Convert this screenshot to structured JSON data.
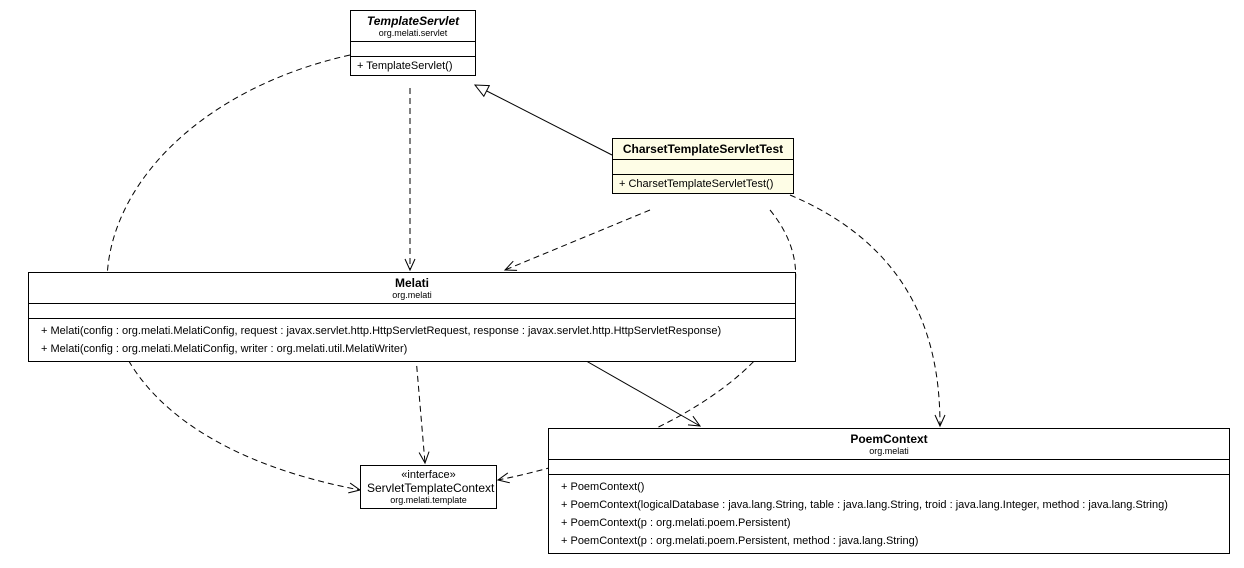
{
  "classes": {
    "templateServlet": {
      "name": "TemplateServlet",
      "package": "org.melati.servlet",
      "methods": [
        "+ TemplateServlet()"
      ]
    },
    "charsetTest": {
      "name": "CharsetTemplateServletTest",
      "methods": [
        "+ CharsetTemplateServletTest()"
      ]
    },
    "melati": {
      "name": "Melati",
      "package": "org.melati",
      "methods": [
        "+ Melati(config : org.melati.MelatiConfig, request : javax.servlet.http.HttpServletRequest, response : javax.servlet.http.HttpServletResponse)",
        "+ Melati(config : org.melati.MelatiConfig, writer : org.melati.util.MelatiWriter)"
      ]
    },
    "servletTemplateContext": {
      "stereotype": "«interface»",
      "name": "ServletTemplateContext",
      "package": "org.melati.template"
    },
    "poemContext": {
      "name": "PoemContext",
      "package": "org.melati",
      "methods": [
        "+ PoemContext()",
        "+ PoemContext(logicalDatabase : java.lang.String, table : java.lang.String, troid : java.lang.Integer, method : java.lang.String)",
        "+ PoemContext(p : org.melati.poem.Persistent)",
        "+ PoemContext(p : org.melati.poem.Persistent, method : java.lang.String)"
      ]
    }
  }
}
